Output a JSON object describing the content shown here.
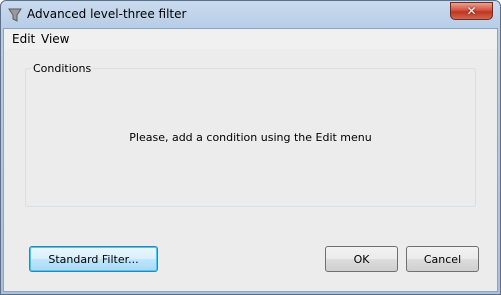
{
  "window": {
    "title": "Advanced level-three filter",
    "close_symbol": "✕"
  },
  "menu": {
    "items": [
      "Edit",
      "View"
    ]
  },
  "conditions": {
    "group_label": "Conditions",
    "hint": "Please, add a condition using the Edit menu"
  },
  "buttons": {
    "standard_filter": "Standard Filter...",
    "ok": "OK",
    "cancel": "Cancel"
  },
  "icons": {
    "app": "filter-icon",
    "close": "close-icon"
  }
}
